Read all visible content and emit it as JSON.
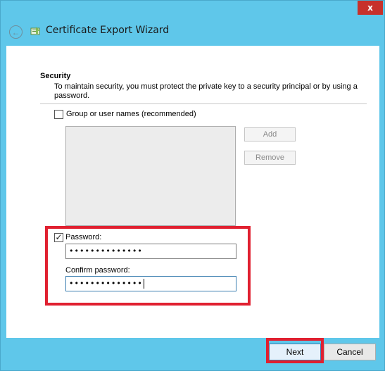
{
  "window": {
    "title": "Certificate Export Wizard",
    "close_label": "x"
  },
  "security": {
    "heading": "Security",
    "description": "To maintain security, you must protect the private key to a security principal or by using a password."
  },
  "group_option": {
    "label": "Group or user names (recommended)",
    "checked": false
  },
  "principal_buttons": {
    "add_label": "Add",
    "remove_label": "Remove"
  },
  "password_option": {
    "label": "Password:",
    "checked": true,
    "check_mark": "✓",
    "value": "••••••••••••••"
  },
  "confirm_password": {
    "label": "Confirm password:",
    "value": "••••••••••••••"
  },
  "footer": {
    "next_label": "Next",
    "cancel_label": "Cancel"
  },
  "colors": {
    "frame": "#5fc7ea",
    "close_button": "#c7312b",
    "highlight": "#e02030"
  },
  "icons": {
    "back": "back-arrow-icon",
    "wizard": "certificate-wizard-icon",
    "close": "close-icon"
  }
}
